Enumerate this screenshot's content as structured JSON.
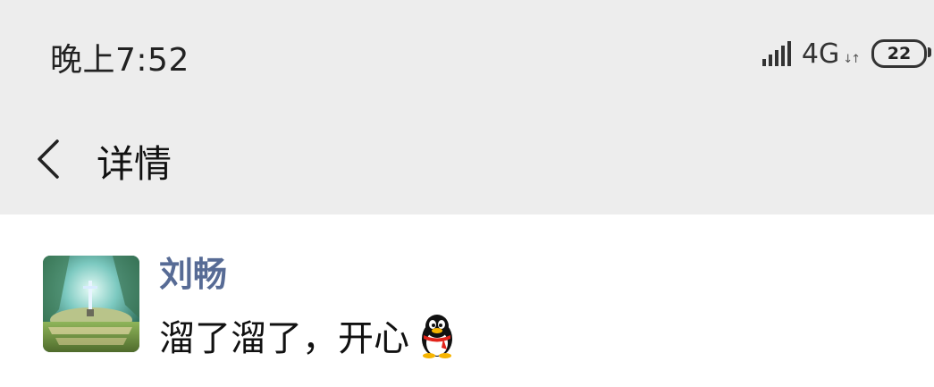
{
  "status_bar": {
    "time": "晚上7:52",
    "network": "4G",
    "battery": "22"
  },
  "nav": {
    "title": "详情"
  },
  "post": {
    "author": "刘畅",
    "text": "溜了溜了，开心"
  },
  "colors": {
    "header_bg": "#ededed",
    "author_name": "#576b95"
  },
  "icons": {
    "back": "chevron-left-icon",
    "emoji": "qq-penguin-icon"
  }
}
